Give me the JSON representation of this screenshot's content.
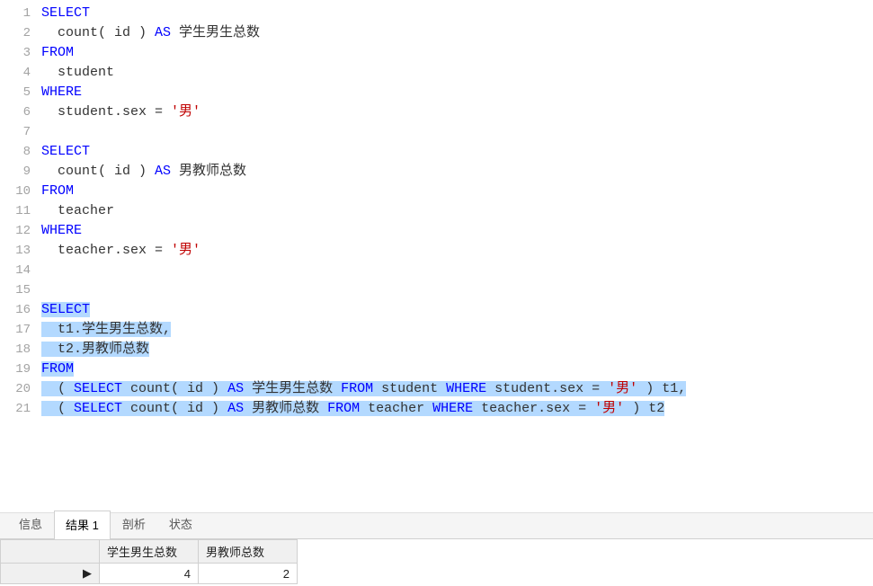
{
  "editor": {
    "lines": [
      {
        "n": 1,
        "tokens": [
          {
            "t": "SELECT",
            "c": "kw"
          }
        ]
      },
      {
        "n": 2,
        "tokens": [
          {
            "t": "  count( id ) ",
            "c": "txt"
          },
          {
            "t": "AS",
            "c": "kw"
          },
          {
            "t": " 学生男生总数",
            "c": "txt"
          }
        ]
      },
      {
        "n": 3,
        "tokens": [
          {
            "t": "FROM",
            "c": "kw"
          }
        ]
      },
      {
        "n": 4,
        "tokens": [
          {
            "t": "  student",
            "c": "txt"
          }
        ]
      },
      {
        "n": 5,
        "tokens": [
          {
            "t": "WHERE",
            "c": "kw"
          }
        ]
      },
      {
        "n": 6,
        "tokens": [
          {
            "t": "  student.sex = ",
            "c": "txt"
          },
          {
            "t": "'男'",
            "c": "str"
          }
        ]
      },
      {
        "n": 7,
        "tokens": []
      },
      {
        "n": 8,
        "tokens": [
          {
            "t": "SELECT",
            "c": "kw"
          }
        ]
      },
      {
        "n": 9,
        "tokens": [
          {
            "t": "  count( id ) ",
            "c": "txt"
          },
          {
            "t": "AS",
            "c": "kw"
          },
          {
            "t": " 男教师总数",
            "c": "txt"
          }
        ]
      },
      {
        "n": 10,
        "tokens": [
          {
            "t": "FROM",
            "c": "kw"
          }
        ]
      },
      {
        "n": 11,
        "tokens": [
          {
            "t": "  teacher",
            "c": "txt"
          }
        ]
      },
      {
        "n": 12,
        "tokens": [
          {
            "t": "WHERE",
            "c": "kw"
          }
        ]
      },
      {
        "n": 13,
        "tokens": [
          {
            "t": "  teacher.sex = ",
            "c": "txt"
          },
          {
            "t": "'男'",
            "c": "str"
          }
        ]
      },
      {
        "n": 14,
        "tokens": []
      },
      {
        "n": 15,
        "tokens": []
      },
      {
        "n": 16,
        "selected": true,
        "tokens": [
          {
            "t": "SELECT",
            "c": "kw"
          }
        ]
      },
      {
        "n": 17,
        "selected": true,
        "tokens": [
          {
            "t": "  t1.学生男生总数,",
            "c": "txt"
          }
        ]
      },
      {
        "n": 18,
        "selected": true,
        "tokens": [
          {
            "t": "  t2.男教师总数",
            "c": "txt"
          }
        ]
      },
      {
        "n": 19,
        "selected": true,
        "tokens": [
          {
            "t": "FROM",
            "c": "kw"
          }
        ]
      },
      {
        "n": 20,
        "selected": true,
        "tokens": [
          {
            "t": "  ( ",
            "c": "txt"
          },
          {
            "t": "SELECT",
            "c": "kw"
          },
          {
            "t": " count( id ) ",
            "c": "txt"
          },
          {
            "t": "AS",
            "c": "kw"
          },
          {
            "t": " 学生男生总数 ",
            "c": "txt"
          },
          {
            "t": "FROM",
            "c": "kw"
          },
          {
            "t": " student ",
            "c": "txt"
          },
          {
            "t": "WHERE",
            "c": "kw"
          },
          {
            "t": " student.sex = ",
            "c": "txt"
          },
          {
            "t": "'男'",
            "c": "str"
          },
          {
            "t": " ) t1,",
            "c": "txt"
          }
        ]
      },
      {
        "n": 21,
        "selected": true,
        "tokens": [
          {
            "t": "  ( ",
            "c": "txt"
          },
          {
            "t": "SELECT",
            "c": "kw"
          },
          {
            "t": " count( id ) ",
            "c": "txt"
          },
          {
            "t": "AS",
            "c": "kw"
          },
          {
            "t": " 男教师总数 ",
            "c": "txt"
          },
          {
            "t": "FROM",
            "c": "kw"
          },
          {
            "t": " teacher ",
            "c": "txt"
          },
          {
            "t": "WHERE",
            "c": "kw"
          },
          {
            "t": " teacher.sex = ",
            "c": "txt"
          },
          {
            "t": "'男'",
            "c": "str"
          },
          {
            "t": " ) t2",
            "c": "txt"
          }
        ]
      }
    ]
  },
  "tabs": {
    "items": [
      {
        "label": "信息",
        "active": false
      },
      {
        "label": "结果 1",
        "active": true
      },
      {
        "label": "剖析",
        "active": false
      },
      {
        "label": "状态",
        "active": false
      }
    ]
  },
  "result": {
    "columns": [
      "学生男生总数",
      "男教师总数"
    ],
    "rows": [
      {
        "values": [
          "4",
          "2"
        ]
      }
    ],
    "row_marker": "▶"
  }
}
